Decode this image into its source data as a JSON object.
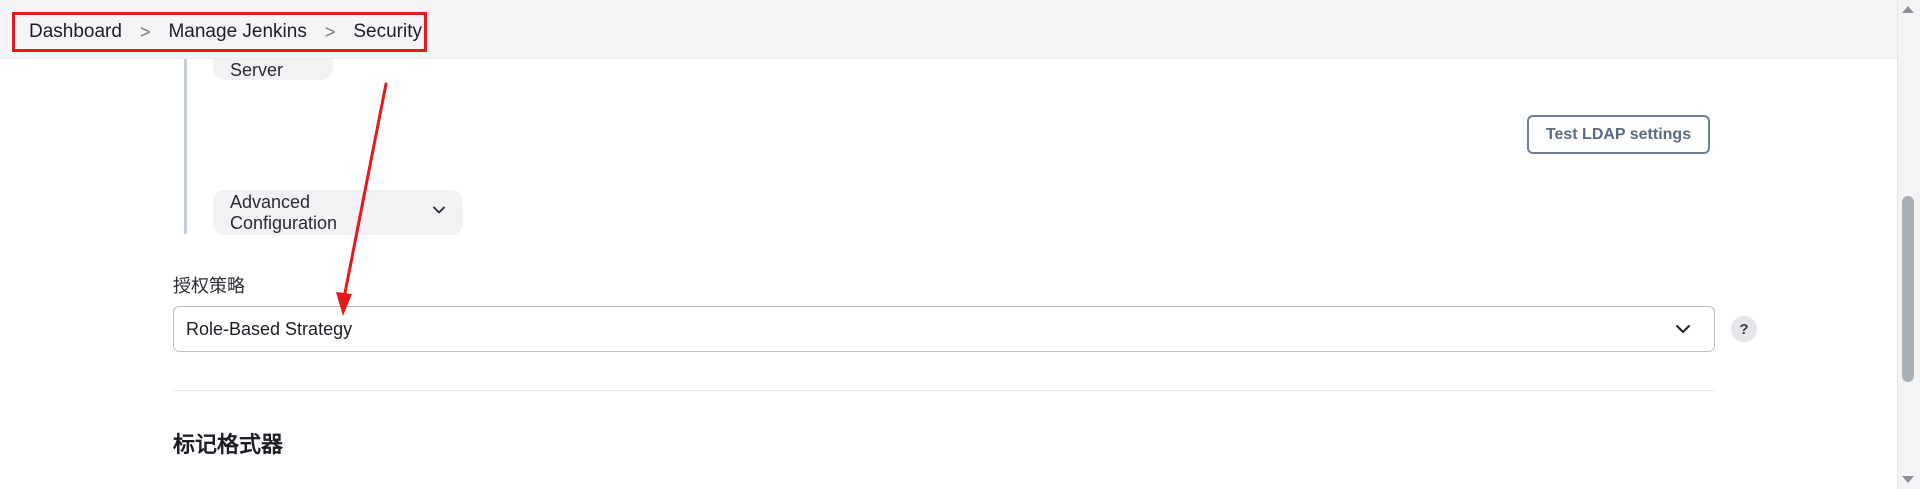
{
  "breadcrumb": {
    "items": [
      "Dashboard",
      "Manage Jenkins",
      "Security"
    ],
    "separator": ">"
  },
  "ldap": {
    "add_server_label": "Add Server",
    "test_button_label": "Test LDAP settings",
    "advanced_config_label": "Advanced Configuration"
  },
  "authorization": {
    "label": "授权策略",
    "selected_value": "Role-Based Strategy",
    "help_label": "?"
  },
  "markup_formatter": {
    "title": "标记格式器"
  },
  "icons": {
    "chevron": "chevron-down-icon",
    "separator": "chevron-right-icon",
    "help": "help-icon"
  },
  "colors": {
    "highlight_box": "#e3191c",
    "annotation_arrow": "#e3191c"
  }
}
